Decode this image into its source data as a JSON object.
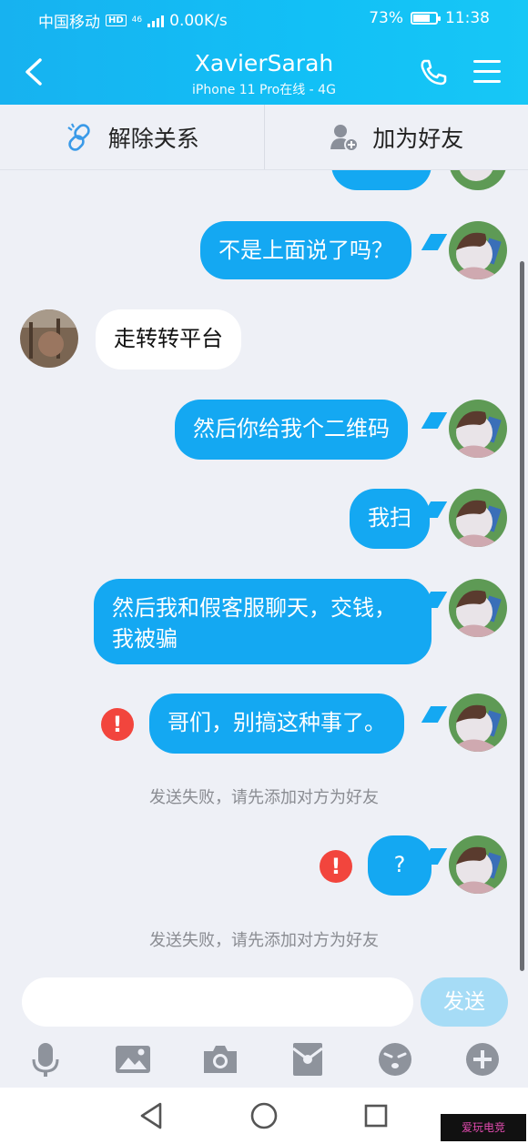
{
  "status_bar": {
    "carrier": "中国移动",
    "hd": "HD",
    "network": "46",
    "speed": "0.00K/s",
    "battery": "73%",
    "battery_level": 0.73,
    "time": "11:38"
  },
  "header": {
    "title": "XavierSarah",
    "subtitle": "iPhone 11 Pro在线 - 4G"
  },
  "actions": {
    "unlink_label": "解除关系",
    "add_friend_label": "加为好友"
  },
  "messages": [
    {
      "side": "me",
      "text": "不是上面说了吗？"
    },
    {
      "side": "other",
      "text": "走转转平台"
    },
    {
      "side": "me",
      "text": "然后你给我个二维码"
    },
    {
      "side": "me",
      "text": "我扫"
    },
    {
      "side": "me",
      "text": "然后我和假客服聊天，交钱，我被骗"
    },
    {
      "side": "me",
      "text": "哥们，别搞这种事了。",
      "failed": true
    },
    {
      "side": "system",
      "text": "发送失败，请先添加对方为好友"
    },
    {
      "side": "me",
      "text": "?",
      "failed": true
    },
    {
      "side": "system",
      "text": "发送失败，请先添加对方为好友"
    }
  ],
  "input": {
    "placeholder": "",
    "send_label": "发送"
  },
  "tools": [
    "microphone-icon",
    "image-icon",
    "camera-icon",
    "red-packet-icon",
    "emoji-icon",
    "plus-icon"
  ],
  "colors": {
    "header": "#12c0f6",
    "my_bubble": "#14a8f2",
    "error": "#f2453d",
    "send_disabled": "#a6dcf6"
  },
  "watermark": "爱玩电竞"
}
